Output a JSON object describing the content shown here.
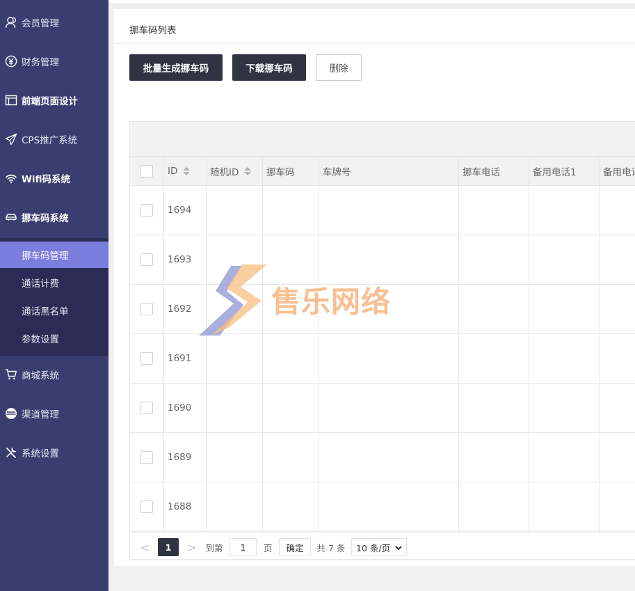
{
  "sidebar": {
    "items": [
      {
        "label": "会员管理",
        "icon": "user-icon"
      },
      {
        "label": "财务管理",
        "icon": "yen-icon"
      },
      {
        "label": "前端页面设计",
        "icon": "layout-icon"
      },
      {
        "label": "CPS推广系统",
        "icon": "paper-plane-icon"
      },
      {
        "label": "Wifi码系统",
        "icon": "wifi-icon"
      },
      {
        "label": "挪车码系统",
        "icon": "car-icon"
      }
    ],
    "submenu": [
      {
        "label": "挪车码管理",
        "active": true
      },
      {
        "label": "通话计费"
      },
      {
        "label": "通话黑名单"
      },
      {
        "label": "参数设置"
      }
    ],
    "items_after": [
      {
        "label": "商城系统",
        "icon": "cart-icon"
      },
      {
        "label": "渠道管理",
        "icon": "channel-icon"
      },
      {
        "label": "系统设置",
        "icon": "tools-icon"
      }
    ]
  },
  "card": {
    "title": "挪车码列表",
    "buttons": {
      "batch_generate": "批量生成挪车码",
      "download": "下载挪车码",
      "delete": "删除"
    }
  },
  "table": {
    "columns": [
      "ID",
      "随机ID",
      "挪车码",
      "车牌号",
      "挪车电话",
      "备用电话1",
      "备用电话"
    ],
    "rows": [
      {
        "id": "1694"
      },
      {
        "id": "1693"
      },
      {
        "id": "1692"
      },
      {
        "id": "1691"
      },
      {
        "id": "1690"
      },
      {
        "id": "1689"
      },
      {
        "id": "1688"
      }
    ]
  },
  "pager": {
    "prev": "<",
    "current": "1",
    "next": ">",
    "goto_label": "到第",
    "goto_value": "1",
    "page_unit": "页",
    "confirm": "确定",
    "total": "共 7 条",
    "page_size": "10 条/页"
  },
  "watermark": {
    "text": "售乐网络"
  },
  "colors": {
    "sidebar_bg": "#393d6f",
    "active_item": "#7a7ddc",
    "primary_button": "#2f3342"
  }
}
